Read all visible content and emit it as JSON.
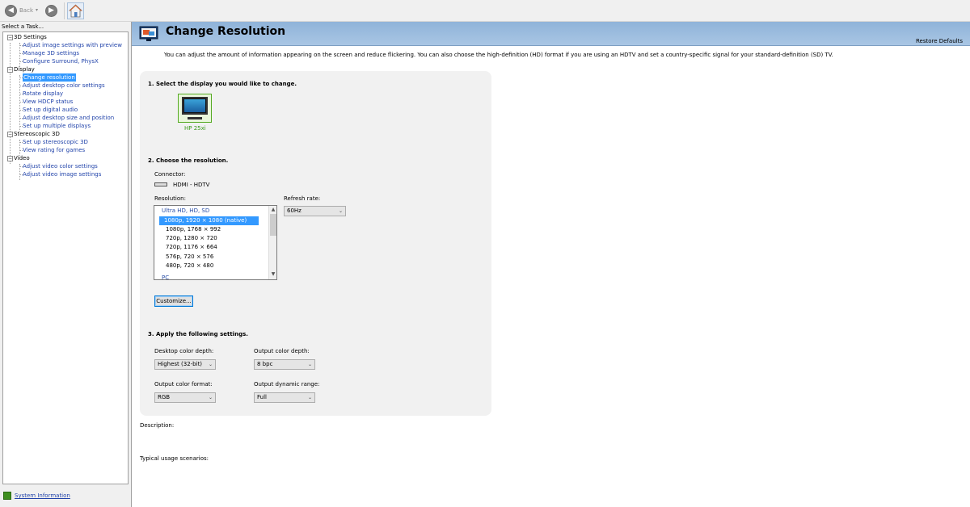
{
  "toolbar": {
    "back_label": "Back",
    "back_arrow": "◀",
    "forward_arrow": "▶",
    "dropdown_glyph": "▾",
    "home_icon": "home-icon"
  },
  "left": {
    "header": "Select a Task...",
    "tree": [
      {
        "label": "3D Settings",
        "type": "category"
      },
      {
        "label": "Adjust image settings with preview",
        "type": "link"
      },
      {
        "label": "Manage 3D settings",
        "type": "link"
      },
      {
        "label": "Configure Surround, PhysX",
        "type": "link"
      },
      {
        "label": "Display",
        "type": "category"
      },
      {
        "label": "Change resolution",
        "type": "link",
        "selected": true
      },
      {
        "label": "Adjust desktop color settings",
        "type": "link"
      },
      {
        "label": "Rotate display",
        "type": "link"
      },
      {
        "label": "View HDCP status",
        "type": "link"
      },
      {
        "label": "Set up digital audio",
        "type": "link"
      },
      {
        "label": "Adjust desktop size and position",
        "type": "link"
      },
      {
        "label": "Set up multiple displays",
        "type": "link"
      },
      {
        "label": "Stereoscopic 3D",
        "type": "category"
      },
      {
        "label": "Set up stereoscopic 3D",
        "type": "link"
      },
      {
        "label": "View rating for games",
        "type": "link"
      },
      {
        "label": "Video",
        "type": "category"
      },
      {
        "label": "Adjust video color settings",
        "type": "link"
      },
      {
        "label": "Adjust video image settings",
        "type": "link"
      }
    ],
    "expander_glyph": "−",
    "system_info": "System Information"
  },
  "main": {
    "title": "Change Resolution",
    "restore_defaults": "Restore Defaults",
    "intro": "You can adjust the amount of information appearing on the screen and reduce flickering. You can also choose the high-definition (HD) format if you are using an HDTV and set a country-specific signal for your standard-definition (SD) TV.",
    "section1": {
      "title": "1. Select the display you would like to change.",
      "display_name": "HP 25xi"
    },
    "section2": {
      "title": "2. Choose the resolution.",
      "connector_label": "Connector:",
      "connector_value": "HDMI - HDTV",
      "resolution_label": "Resolution:",
      "refresh_label": "Refresh rate:",
      "refresh_value": "60Hz",
      "resolution_list": [
        {
          "label": "Ultra HD, HD, SD",
          "type": "group"
        },
        {
          "label": "1080p, 1920 × 1080 (native)",
          "type": "item",
          "selected": true
        },
        {
          "label": "1080p, 1768 × 992",
          "type": "item"
        },
        {
          "label": "720p, 1280 × 720",
          "type": "item"
        },
        {
          "label": "720p, 1176 × 664",
          "type": "item"
        },
        {
          "label": "576p, 720 × 576",
          "type": "item"
        },
        {
          "label": "480p, 720 × 480",
          "type": "item"
        },
        {
          "label": "PC",
          "type": "group"
        }
      ],
      "customize_button": "Customize..."
    },
    "section3": {
      "title": "3. Apply the following settings.",
      "desktop_color_depth_label": "Desktop color depth:",
      "desktop_color_depth_value": "Highest (32-bit)",
      "output_color_depth_label": "Output color depth:",
      "output_color_depth_value": "8 bpc",
      "output_color_format_label": "Output color format:",
      "output_color_format_value": "RGB",
      "output_dynamic_range_label": "Output dynamic range:",
      "output_dynamic_range_value": "Full"
    },
    "description_label": "Description:",
    "typical_usage_label": "Typical usage scenarios:"
  },
  "colors": {
    "accent": "#3399ff",
    "link": "#2244aa",
    "banner": "#9dbde0",
    "display_label": "#3a9a1a"
  }
}
